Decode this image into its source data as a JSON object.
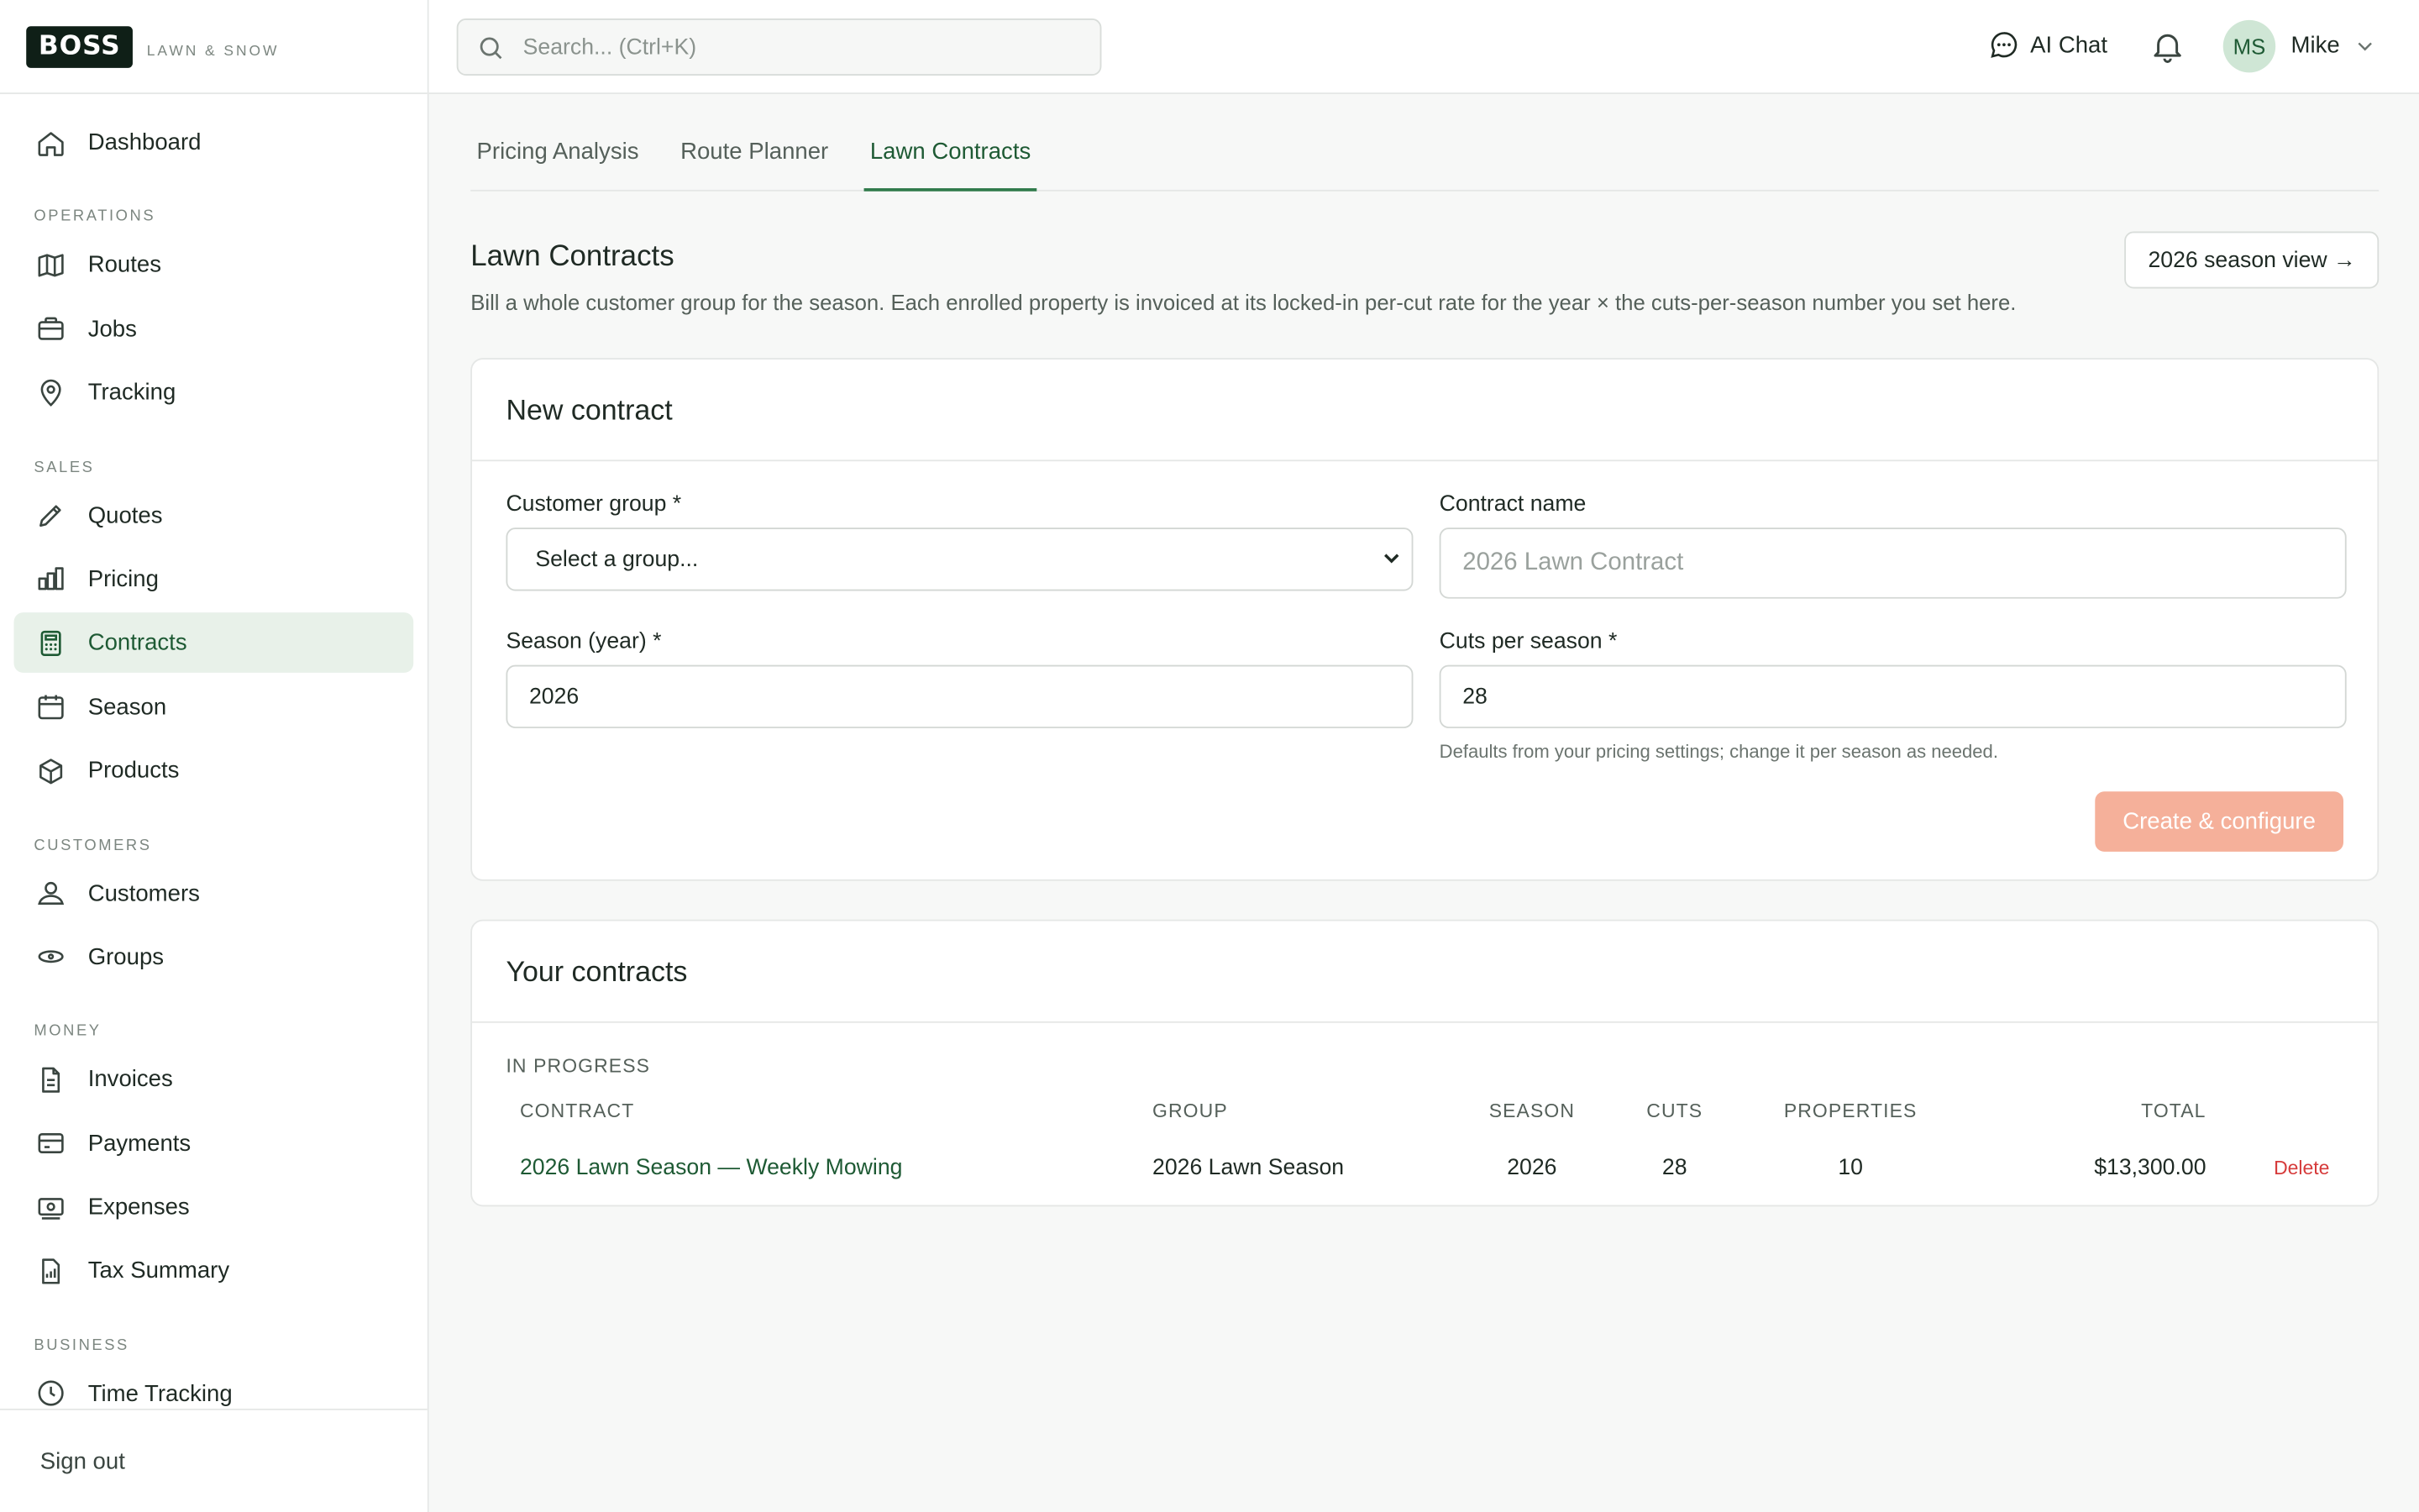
{
  "brand": {
    "logo": "BOSS",
    "subtitle": "LAWN & SNOW"
  },
  "sidebar": {
    "dashboard": "Dashboard",
    "sections": {
      "operations": "OPERATIONS",
      "sales": "SALES",
      "customers": "CUSTOMERS",
      "money": "MONEY",
      "business": "BUSINESS"
    },
    "items": {
      "routes": "Routes",
      "jobs": "Jobs",
      "tracking": "Tracking",
      "quotes": "Quotes",
      "pricing": "Pricing",
      "contracts": "Contracts",
      "season": "Season",
      "products": "Products",
      "customers": "Customers",
      "groups": "Groups",
      "invoices": "Invoices",
      "payments": "Payments",
      "expenses": "Expenses",
      "tax_summary": "Tax Summary",
      "time_tracking": "Time Tracking"
    },
    "active": "contracts",
    "sign_out": "Sign out"
  },
  "topbar": {
    "search_placeholder": "Search... (Ctrl+K)",
    "ai_chat": "AI Chat",
    "avatar_initials": "MS",
    "user_name": "Mike"
  },
  "tabs": {
    "pricing_analysis": "Pricing Analysis",
    "route_planner": "Route Planner",
    "lawn_contracts": "Lawn Contracts",
    "active": "lawn_contracts"
  },
  "page": {
    "title": "Lawn Contracts",
    "description": "Bill a whole customer group for the season. Each enrolled property is invoiced at its locked-in per-cut rate for the year × the cuts-per-season number you set here.",
    "season_view_button": "2026 season view →"
  },
  "new_contract": {
    "heading": "New contract",
    "customer_group_label": "Customer group *",
    "customer_group_value": "Select a group...",
    "contract_name_label": "Contract name",
    "contract_name_placeholder": "2026 Lawn Contract",
    "season_label": "Season (year) *",
    "season_value": "2026",
    "cuts_label": "Cuts per season *",
    "cuts_value": "28",
    "cuts_hint": "Defaults from your pricing settings; change it per season as needed.",
    "create_button": "Create & configure"
  },
  "your_contracts": {
    "heading": "Your contracts",
    "section_label": "IN PROGRESS",
    "columns": {
      "contract": "CONTRACT",
      "group": "GROUP",
      "season": "SEASON",
      "cuts": "CUTS",
      "properties": "PROPERTIES",
      "total": "TOTAL"
    },
    "rows": [
      {
        "contract": "2026 Lawn Season — Weekly Mowing",
        "group": "2026 Lawn Season",
        "season": "2026",
        "cuts": "28",
        "properties": "10",
        "total": "$13,300.00",
        "action": "Delete"
      }
    ]
  },
  "colors": {
    "brand_green": "#1e5a34",
    "active_nav_bg": "#e8f1e9",
    "create_button": "#f5b09a",
    "delete": "#d63b3b"
  }
}
